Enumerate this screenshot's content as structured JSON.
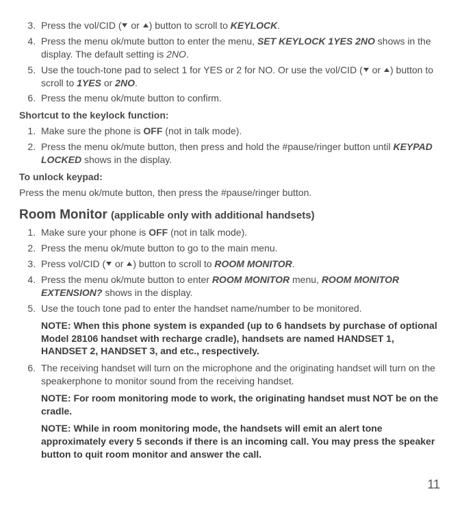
{
  "listA": {
    "i3": {
      "a": "Press the vol/CID (",
      "b": " or ",
      "c": ") button to scroll to ",
      "kw": "KEYLOCK",
      "d": "."
    },
    "i4": {
      "a": "Press the menu ok/mute button to enter the menu, ",
      "kw": "SET KEYLOCK 1YES  2NO",
      "b": " shows in the display. The default setting is ",
      "def": "2NO",
      "c": "."
    },
    "i5": {
      "a": "Use the touch-tone pad to select 1 for YES or 2 for NO. Or use the vol/CID (",
      "b": " or ",
      "c": ") button to scroll to ",
      "opt1": "1YES",
      "d": " or ",
      "opt2": "2NO",
      "e": "."
    },
    "i6": "Press the menu ok/mute button to confirm."
  },
  "shortcut_head": "Shortcut to the keylock function:",
  "listB": {
    "i1": {
      "a": "Make sure the phone is ",
      "kw": "OFF",
      "b": " (not in talk mode)."
    },
    "i2": {
      "a": "Press the menu ok/mute button, then press and hold the #pause/ringer button until ",
      "kw": "KEYPAD LOCKED",
      "b": " shows in the display."
    }
  },
  "unlock_head": "To unlock keypad:",
  "unlock_text": "Press the menu ok/mute button, then press the #pause/ringer button.",
  "room_title": "Room Monitor ",
  "room_sub": "(applicable only with additional handsets)",
  "listC": {
    "i1": {
      "a": "Make sure your phone is ",
      "kw": "OFF",
      "b": " (not in talk mode)."
    },
    "i2": "Press the menu ok/mute button to go to the main menu.",
    "i3": {
      "a": "Press vol/CID (",
      "b": " or ",
      "c": ") button to scroll to ",
      "kw": "ROOM MONITOR",
      "d": "."
    },
    "i4": {
      "a": "Press the menu ok/mute button to enter ",
      "kw1": "ROOM MONITOR",
      "b": " menu, ",
      "kw2": "ROOM MONITOR EXTENSION?",
      "c": " shows in the display."
    },
    "i5": "Use the touch tone pad to enter the handset name/number to be monitored.",
    "note1": "NOTE: When this phone system is expanded (up to 6 handsets by purchase of optional Model 28106 handset with recharge cradle), handsets are named HANDSET 1, HANDSET 2, HANDSET 3, and etc., respectively.",
    "i6": "The receiving handset will turn on the microphone and the originating handset will turn on the speakerphone to monitor sound from the receiving handset.",
    "note2": "NOTE: For room monitoring mode to work, the originating handset must NOT be on the cradle.",
    "note3": "NOTE: While in room monitoring mode, the handsets will emit an alert tone approximately every 5 seconds if there is an incoming call. You may press the speaker button to quit room monitor and answer the call."
  },
  "page": "11"
}
